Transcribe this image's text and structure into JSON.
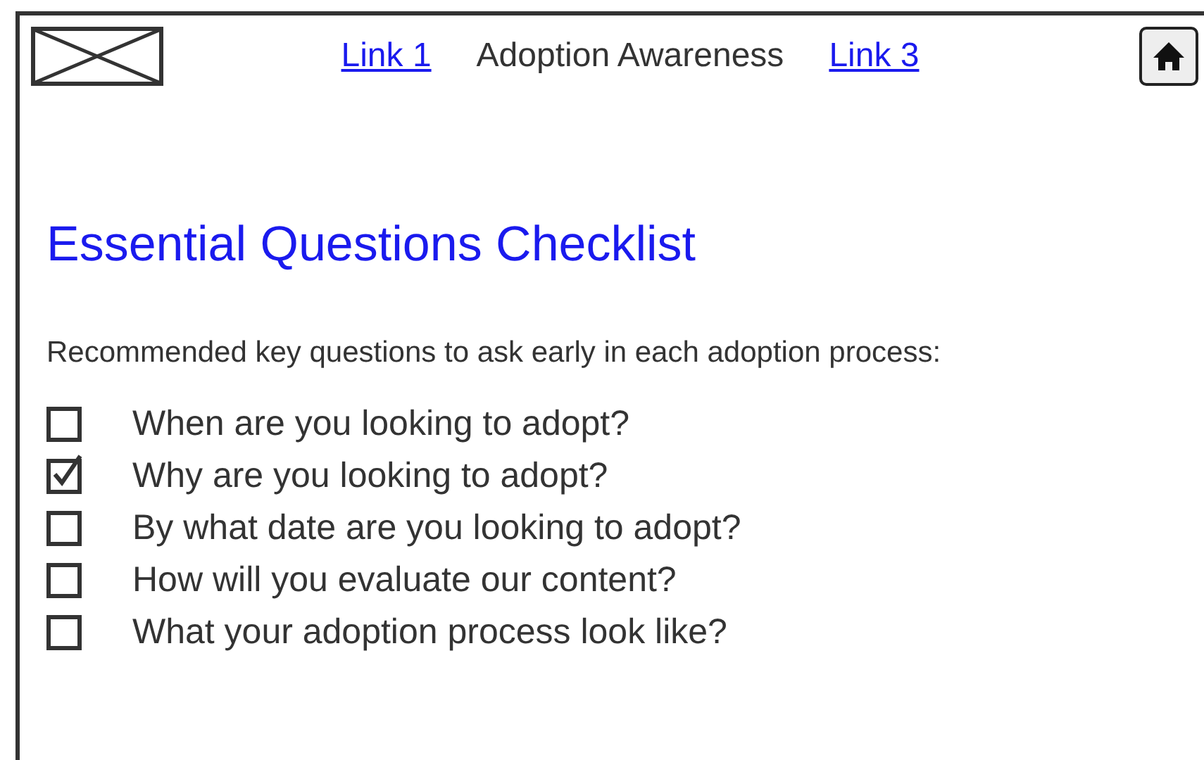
{
  "nav": [
    {
      "kind": "link",
      "label": "Link 1"
    },
    {
      "kind": "text",
      "label": "Adoption Awareness"
    },
    {
      "kind": "link",
      "label": "Link 3"
    }
  ],
  "title": "Essential Questions Checklist",
  "intro": "Recommended key questions to ask early in each adoption process:",
  "checklist": [
    {
      "label": "When are you looking to adopt?",
      "checked": false
    },
    {
      "label": "Why are you looking to adopt?",
      "checked": true
    },
    {
      "label": "By what date are you looking to adopt?",
      "checked": false
    },
    {
      "label": "How will you evaluate our content?",
      "checked": false
    },
    {
      "label": "What your adoption process look like?",
      "checked": false
    }
  ]
}
